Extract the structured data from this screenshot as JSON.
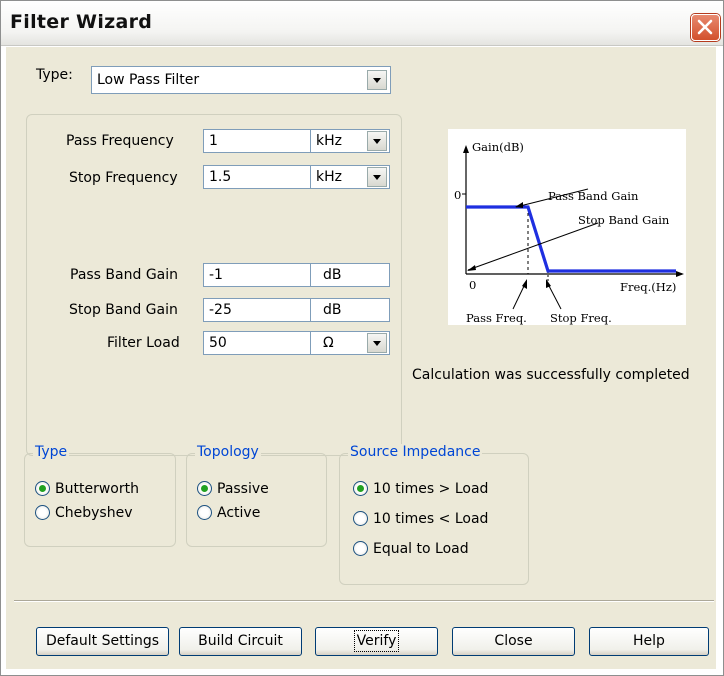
{
  "window": {
    "title": "Filter Wizard",
    "close_glyph": "close-icon"
  },
  "type_row": {
    "label": "Type:",
    "value": "Low Pass Filter"
  },
  "fields": {
    "pass_frequency": {
      "label": "Pass Frequency",
      "value": "1",
      "unit": "kHz"
    },
    "stop_frequency": {
      "label": "Stop Frequency",
      "value": "1.5",
      "unit": "kHz"
    },
    "pass_band_gain": {
      "label": "Pass Band Gain",
      "value": "-1",
      "unit": "dB"
    },
    "stop_band_gain": {
      "label": "Stop Band Gain",
      "value": "-25",
      "unit": "dB"
    },
    "filter_load": {
      "label": "Filter Load",
      "value": "50",
      "unit": "Ω"
    }
  },
  "diagram": {
    "y_axis": "Gain(dB)",
    "zero_y": "0",
    "zero_x": "0",
    "pass_band_gain": "Pass Band Gain",
    "stop_band_gain": "Stop Band Gain",
    "x_axis": "Freq.(Hz)",
    "pass_freq": "Pass Freq.",
    "stop_freq": "Stop Freq."
  },
  "status": "Calculation was successfully completed",
  "groups": {
    "type": {
      "legend": "Type",
      "options": [
        "Butterworth",
        "Chebyshev"
      ],
      "selected": 0
    },
    "topology": {
      "legend": "Topology",
      "options": [
        "Passive",
        "Active"
      ],
      "selected": 0
    },
    "source_impedance": {
      "legend": "Source Impedance",
      "options": [
        "10 times > Load",
        "10 times < Load",
        "Equal to Load"
      ],
      "selected": 0
    }
  },
  "buttons": {
    "default_settings": "Default Settings",
    "build_circuit": "Build Circuit",
    "verify": "Verify",
    "close": "Close",
    "help": "Help"
  },
  "colors": {
    "legend_blue": "#0046d5",
    "curve_blue": "#1e2fe0",
    "close_red": "#d2502c"
  }
}
